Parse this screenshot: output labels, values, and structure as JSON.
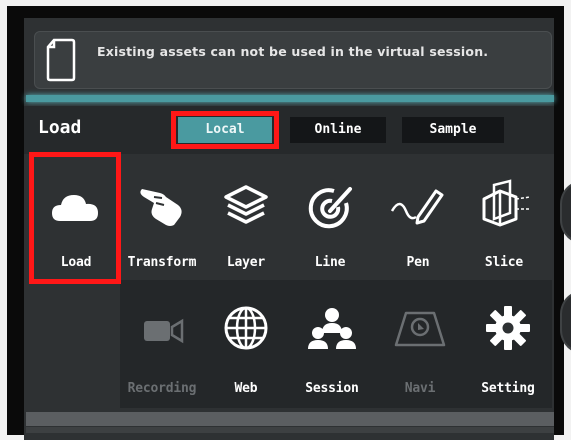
{
  "notice": {
    "text": "Existing assets can not be used in the virtual session."
  },
  "toolbar": {
    "title": "Load",
    "tabs": [
      {
        "label": "Local",
        "active": true
      },
      {
        "label": "Online",
        "active": false
      },
      {
        "label": "Sample",
        "active": false
      }
    ]
  },
  "tools_row1": [
    {
      "label": "Load",
      "icon": "cloud-icon",
      "highlighted": true
    },
    {
      "label": "Transform",
      "icon": "hand-icon"
    },
    {
      "label": "Layer",
      "icon": "layers-icon"
    },
    {
      "label": "Line",
      "icon": "line-target-icon"
    },
    {
      "label": "Pen",
      "icon": "pen-icon"
    },
    {
      "label": "Slice",
      "icon": "slice-icon"
    }
  ],
  "tools_row2": [
    {
      "label": "Recording",
      "icon": "camera-icon",
      "enabled": false
    },
    {
      "label": "Web",
      "icon": "globe-icon",
      "enabled": true
    },
    {
      "label": "Session",
      "icon": "users-icon",
      "enabled": true
    },
    {
      "label": "Navi",
      "icon": "navigation-icon",
      "enabled": false
    },
    {
      "label": "Setting",
      "icon": "gear-icon",
      "enabled": true
    }
  ],
  "colors": {
    "accent": "#4a9aa0",
    "highlight": "#ff1717",
    "panel": "#2e3133",
    "disabled": "#6b6f72"
  }
}
